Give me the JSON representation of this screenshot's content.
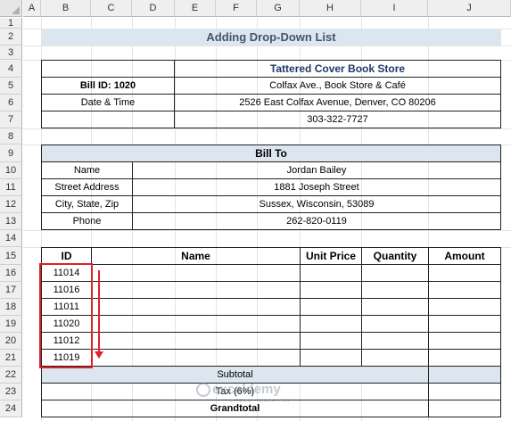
{
  "columns": [
    "A",
    "B",
    "C",
    "D",
    "E",
    "F",
    "G",
    "H",
    "I",
    "J"
  ],
  "rows": [
    "1",
    "2",
    "3",
    "4",
    "5",
    "6",
    "7",
    "8",
    "9",
    "10",
    "11",
    "12",
    "13",
    "14",
    "15",
    "16",
    "17",
    "18",
    "19",
    "20",
    "21",
    "22",
    "23",
    "24"
  ],
  "title": "Adding Drop-Down List",
  "store": {
    "name": "Tattered Cover Book Store",
    "bill_id": "Bill ID: 1020",
    "datetime_label": "Date & Time",
    "line1": "Colfax Ave., Book Store & Café",
    "line2": "2526 East Colfax Avenue, Denver, CO 80206",
    "phone": "303-322-7727"
  },
  "bill_to": {
    "header": "Bill To",
    "rows": [
      {
        "label": "Name",
        "value": "Jordan Bailey"
      },
      {
        "label": "Street Address",
        "value": "1881 Joseph Street"
      },
      {
        "label": "City, State, Zip",
        "value": "Sussex, Wisconsin, 53089"
      },
      {
        "label": "Phone",
        "value": "262-820-0119"
      }
    ]
  },
  "items_table": {
    "headers": {
      "id": "ID",
      "name": "Name",
      "unit_price": "Unit Price",
      "quantity": "Quantity",
      "amount": "Amount"
    },
    "ids": [
      "11014",
      "11016",
      "11011",
      "11020",
      "11012",
      "11019"
    ]
  },
  "totals": {
    "subtotal": "Subtotal",
    "tax": "Tax (6%)",
    "grandtotal": "Grandtotal"
  },
  "watermark": {
    "brand": "exceldemy",
    "tagline": "EXCEL · DATA · BI"
  },
  "colors": {
    "accent": "#dce6f1",
    "highlight": "#e0202b",
    "title_text": "#44546a"
  }
}
